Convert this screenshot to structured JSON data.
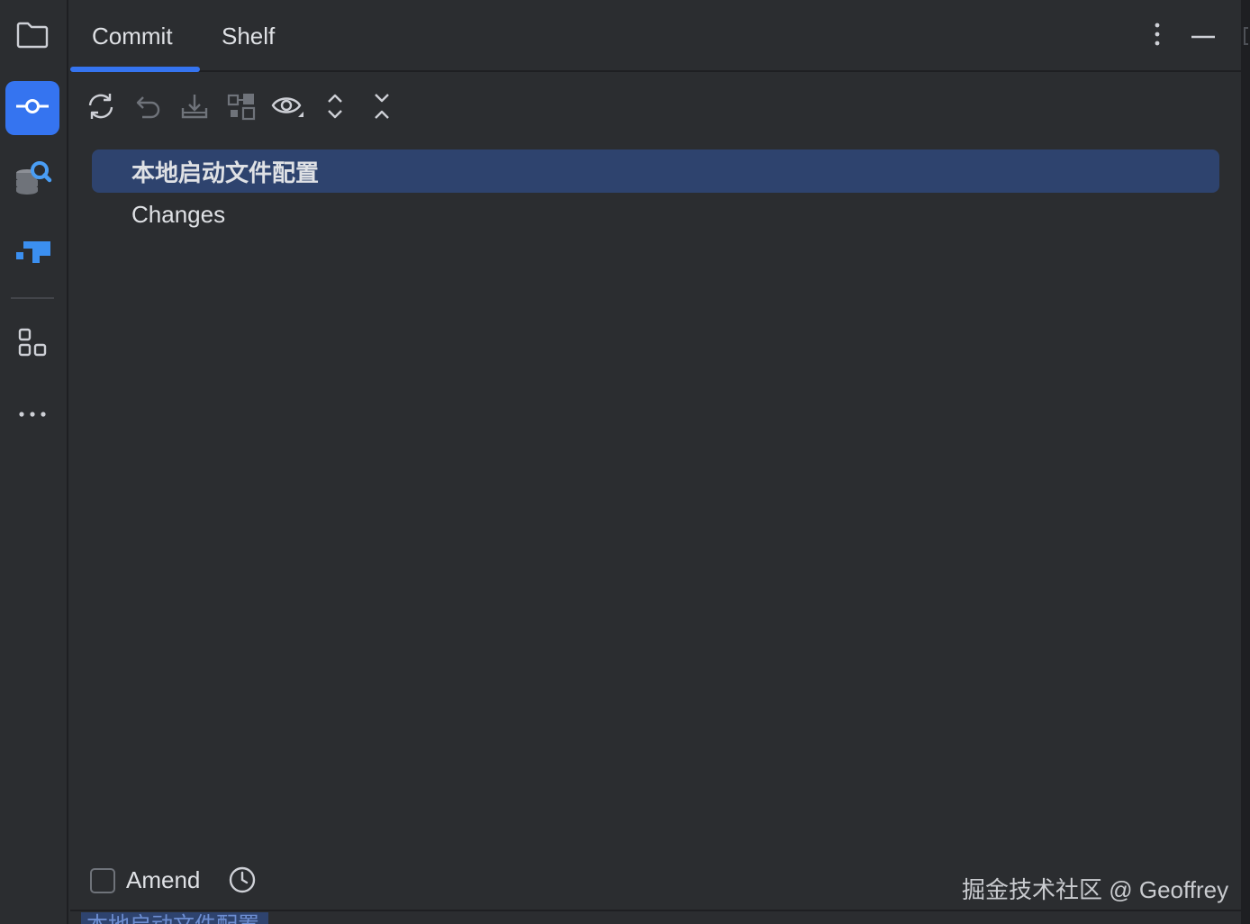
{
  "toolstrip": {
    "items": [
      {
        "name": "project",
        "icon": "folder-icon"
      },
      {
        "name": "commit",
        "icon": "commit-icon",
        "active": true
      },
      {
        "name": "database",
        "icon": "database-search-icon"
      },
      {
        "name": "plugin",
        "icon": "plugin-logo-icon"
      },
      {
        "name": "structure",
        "icon": "structure-icon"
      },
      {
        "name": "more",
        "icon": "more-horizontal-icon"
      }
    ]
  },
  "tabs": [
    {
      "label": "Commit",
      "active": true
    },
    {
      "label": "Shelf",
      "active": false
    }
  ],
  "toolbar": {
    "icons": [
      "refresh-icon",
      "rollback-icon",
      "update-icon",
      "group-by-icon",
      "view-options-icon",
      "expand-all-icon",
      "collapse-all-icon"
    ]
  },
  "tree": {
    "rows": [
      {
        "label": "本地启动文件配置",
        "selected": true
      },
      {
        "label": "Changes",
        "selected": false
      }
    ]
  },
  "footer": {
    "amend_label": "Amend",
    "amend_checked": false,
    "watermark": "掘金技术社区 @ Geoffrey"
  },
  "bottom": {
    "changelist_chip": "本地启动文件配置"
  },
  "colors": {
    "background": "#2b2d30",
    "accent": "#3574f0",
    "selection": "#2e436e",
    "text": "#dfe1e5"
  }
}
